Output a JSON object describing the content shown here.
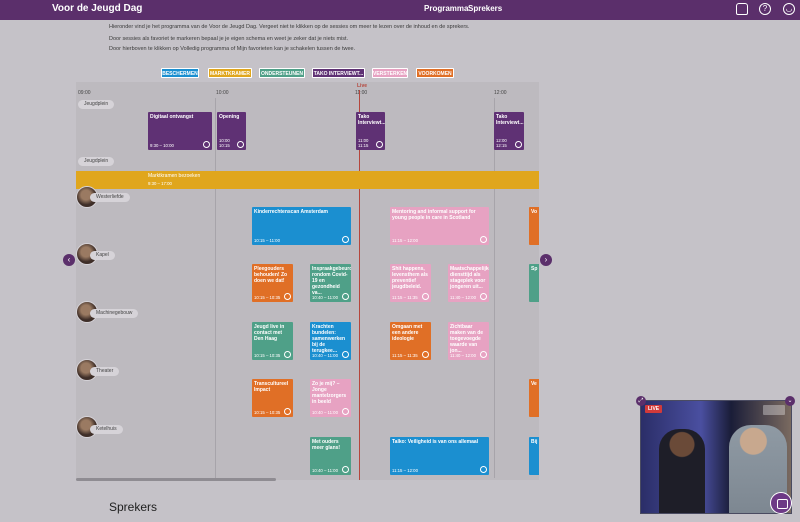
{
  "header": {
    "brand": "Voor de Jeugd Dag",
    "nav": [
      "Programma",
      "Sprekers"
    ],
    "icons": [
      "bell-icon",
      "help-icon",
      "user-icon"
    ]
  },
  "intro": [
    "Hieronder vind je het programma van de Voor de Jeugd Dag. Vergeet niet te klikken op de sessies om meer te lezen over de inhoud en de sprekers.",
    "Door sessies als favoriet te markeren bepaal je je eigen schema en weet je zeker dat je niets mist.",
    "Door hierboven te klikken op Volledig programma of Mijn favorieten kan je schakelen tussen de twee."
  ],
  "filters": [
    {
      "label": "BESCHERMEN",
      "color": "#1b8fd0"
    },
    {
      "label": "MARKTKRAMER",
      "color": "#e0a61d"
    },
    {
      "label": "ONDERSTEUNEN",
      "color": "#4fa088"
    },
    {
      "label": "TAKO INTERVIEWT...",
      "color": "#5f3174"
    },
    {
      "label": "VERSTERKEN",
      "color": "#e7a2c2"
    },
    {
      "label": "VOORKOMEN",
      "color": "#e06f26"
    }
  ],
  "schedule": {
    "times": [
      "09:00",
      "10:00",
      "11:00",
      "12:00"
    ],
    "live_label": "Live",
    "locations": [
      "Jeugdplein",
      "Jeugdplein",
      "Westerliefde",
      "Kapel",
      "Machinegebouw",
      "Theater",
      "Ketelhuis"
    ],
    "band": {
      "title": "Marktkramen bezoeken",
      "time": "9:30 – 17:00"
    },
    "events": [
      {
        "title": "Digitaal ontvangst",
        "time": "9:30 – 10:00"
      },
      {
        "title": "Opening",
        "time": "10:00\n10:15"
      },
      {
        "title": "Tako Interviewt...",
        "time": "11:00\n11:15"
      },
      {
        "title": "Tako Interviewt...",
        "time": "12:00\n12:15"
      },
      {
        "title": "Kinderrechtenscan Amsterdam",
        "time": "10:15 – 11:00"
      },
      {
        "title": "Mentoring and informal support for young people in care in Scotland",
        "time": "11:15 – 12:00"
      },
      {
        "title": "Pleegouders behouden! Zo doen we dat!",
        "time": "10:15 – 10:35"
      },
      {
        "title": "Inspraakgebeurd rondom Covid-19 en gezondheid va...",
        "time": "10:40 – 11:00"
      },
      {
        "title": "Shit happens, levensthem als preventief jeugdbeleid.",
        "time": "11:15 – 11:35"
      },
      {
        "title": "Maatschappelijke diensttijd als stageplek voor jongeren uit...",
        "time": "11:40 – 12:00"
      },
      {
        "title": "Jeugd live in contact met Den Haag",
        "time": "10:15 – 10:35"
      },
      {
        "title": "Krachten bundelen: samenwerken bij de terugkee...",
        "time": "10:40 – 11:00"
      },
      {
        "title": "Omgaan met een andere ideologie",
        "time": "11:15 – 11:35"
      },
      {
        "title": "Zichtbaar maken van de toegevoegde waarde van jon...",
        "time": "11:40 – 12:00"
      },
      {
        "title": "Transcultureel Impact",
        "time": "10:15 – 10:35"
      },
      {
        "title": "Zo je mij? – Jonge mantelzorgers in beeld",
        "time": "10:40 – 11:00"
      },
      {
        "title": "Met ouders meer glans!",
        "time": "10:40 – 11:00"
      },
      {
        "title": "Talko: Veiligheid is van ons allemaal",
        "time": "11:15 – 12:00"
      },
      {
        "title": "Vo",
        "time": ""
      },
      {
        "title": "Sp",
        "time": ""
      },
      {
        "title": "Ve",
        "time": ""
      },
      {
        "title": "Bij",
        "time": ""
      }
    ]
  },
  "speakers_heading": "Sprekers",
  "video": {
    "live": "LIVE"
  }
}
